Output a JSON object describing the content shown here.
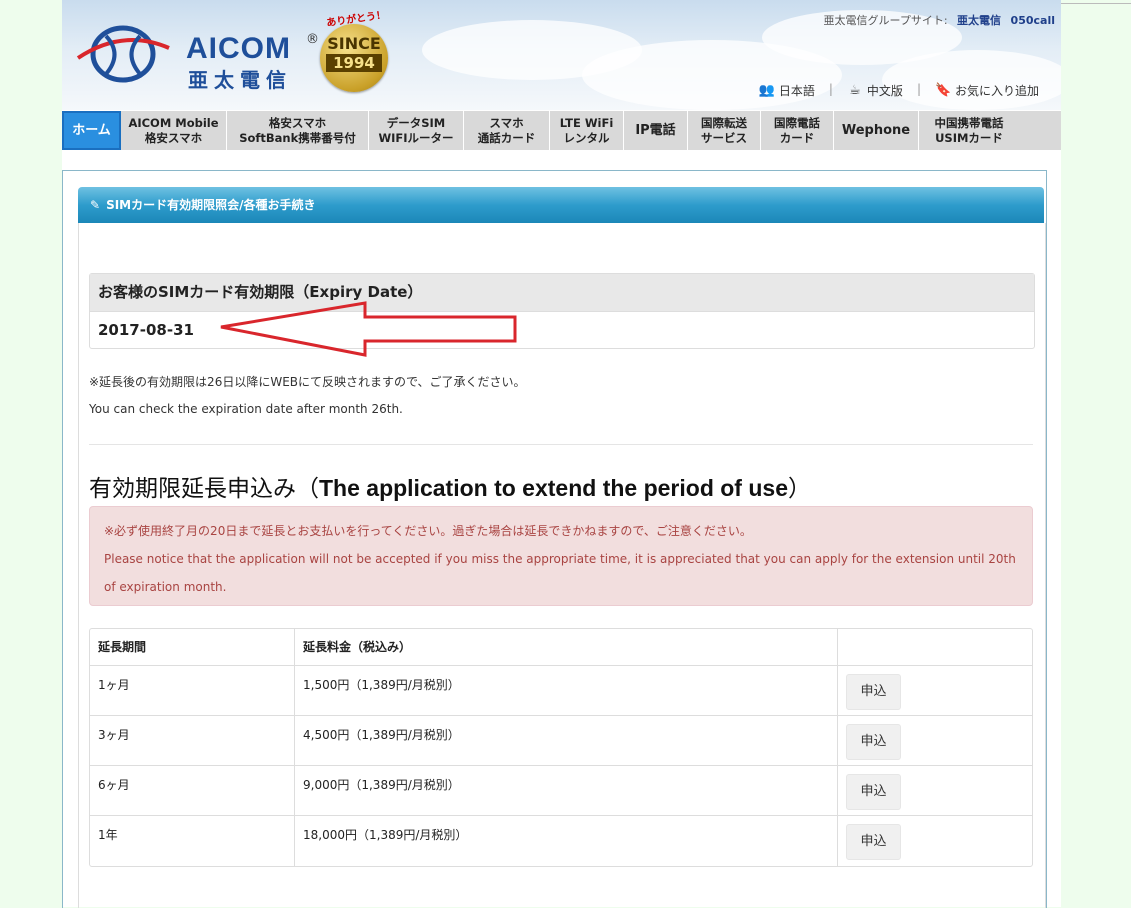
{
  "header": {
    "logo_text": "AICOM",
    "logo_sub": "亜太電信",
    "logo_reg": "®",
    "badge_top": "ありがとう！",
    "badge_word": "SINCE",
    "badge_year": "1994",
    "group_label": "亜太電信グループサイト:",
    "group_links": [
      "亜太電信",
      "050call"
    ],
    "langs": [
      {
        "label": "日本語",
        "icon": "people-icon"
      },
      {
        "label": "中文版",
        "icon": "cup-icon"
      },
      {
        "label": "お気に入り追加",
        "icon": "bookmark-icon"
      }
    ]
  },
  "nav": {
    "home": "ホーム",
    "items": [
      {
        "l1": "AICOM Mobile",
        "l2": "格安スマホ"
      },
      {
        "l1": "格安スマホ",
        "l2": "SoftBank携帯番号付"
      },
      {
        "l1": "データSIM",
        "l2": "WIFIルーター"
      },
      {
        "l1": "スマホ",
        "l2": "通話カード"
      },
      {
        "l1": "LTE WiFi",
        "l2": "レンタル"
      },
      {
        "l1": "IP電話",
        "l2": ""
      },
      {
        "l1": "国際転送",
        "l2": "サービス"
      },
      {
        "l1": "国際電話",
        "l2": "カード"
      },
      {
        "l1": "Wephone",
        "l2": ""
      },
      {
        "l1": "中国携帯電話",
        "l2": "USIMカード"
      }
    ]
  },
  "panel": {
    "title": "SIMカード有効期限照会/各種お手続き"
  },
  "expiry": {
    "label": "お客様のSIMカード有効期限（Expiry Date）",
    "value": "2017-08-31"
  },
  "notes": {
    "jp": "※延長後の有効期限は26日以降にWEBにて反映されますので、ご了承ください。",
    "en": "You can check the expiration date after month 26th."
  },
  "extension": {
    "title_jp": "有効期限延長申込み（",
    "title_en": "The application to extend the period of use",
    "title_end": "）",
    "alert_jp": "※必ず使用終了月の20日まで延長とお支払いを行ってください。過ぎた場合は延長できかねますので、ご注意ください。",
    "alert_en": "Please notice that the application will not be accepted if you miss the appropriate time, it is appreciated that you can apply for the extension until 20th of expiration month."
  },
  "table": {
    "headers": [
      "延長期間",
      "延長料金（税込み）",
      ""
    ],
    "rows": [
      {
        "period": "1ヶ月",
        "price": "1,500円（1,389円/月税別）",
        "action": "申込"
      },
      {
        "period": "3ヶ月",
        "price": "4,500円（1,389円/月税別）",
        "action": "申込"
      },
      {
        "period": "6ヶ月",
        "price": "9,000円（1,389円/月税別）",
        "action": "申込"
      },
      {
        "period": "1年",
        "price": "18,000円（1,389円/月税別）",
        "action": "申込"
      }
    ]
  },
  "colors": {
    "nav_home": "#2a8fe0",
    "panel_head": "#2e9ccc",
    "alert_bg": "#f2dede",
    "alert_text": "#a94442",
    "arrow": "#d9262c",
    "background": "#eefded"
  }
}
